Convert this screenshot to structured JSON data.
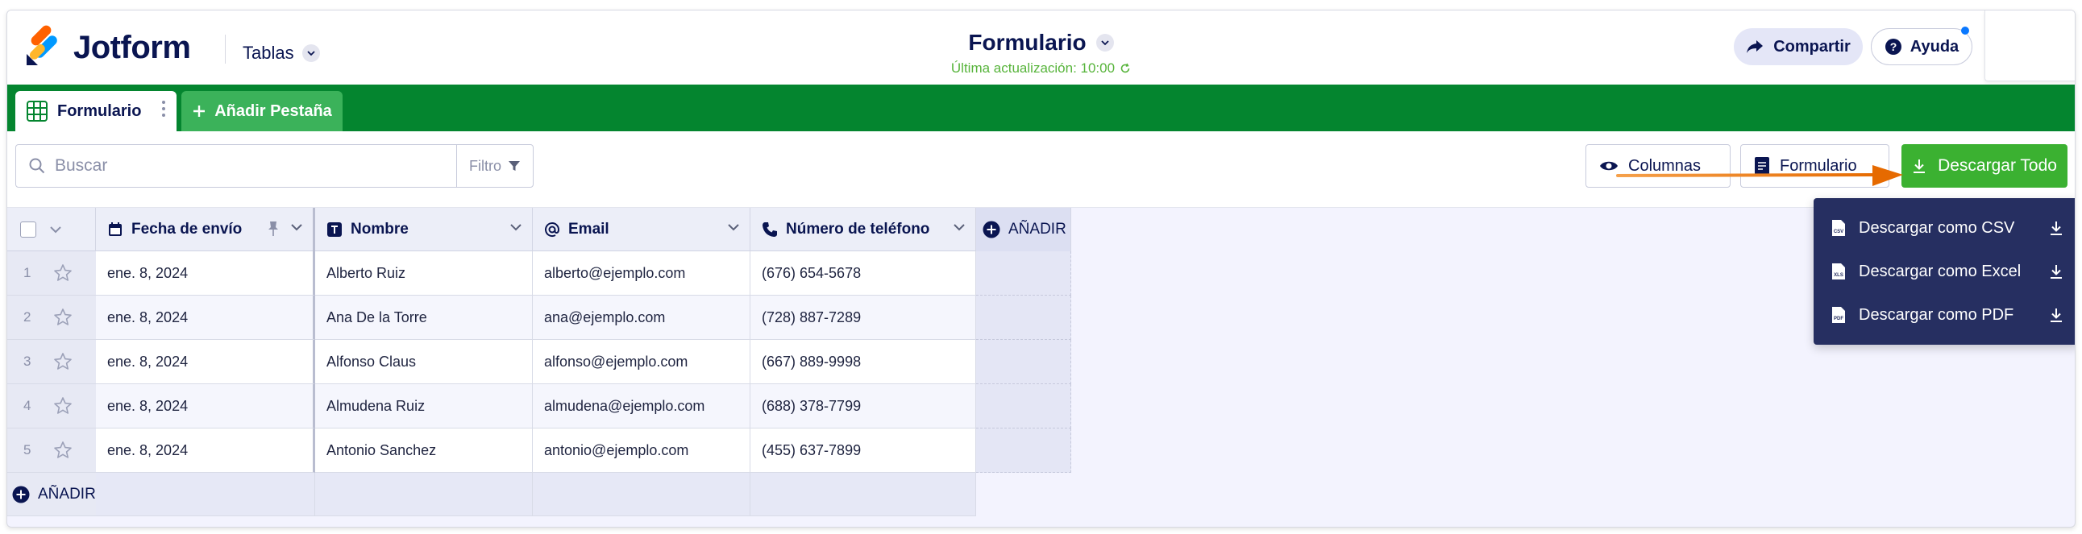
{
  "header": {
    "brand": "Jotform",
    "tables_label": "Tablas",
    "form_title": "Formulario",
    "last_update": "Última actualización: 10:00",
    "share_label": "Compartir",
    "help_label": "Ayuda"
  },
  "tabs": {
    "active_tab": "Formulario",
    "add_tab": "Añadir Pestaña"
  },
  "toolbar": {
    "search_placeholder": "Buscar",
    "filter_label": "Filtro",
    "columns_label": "Columnas",
    "form_label": "Formulario",
    "download_all_label": "Descargar Todo"
  },
  "table": {
    "columns": [
      "Fecha de envío",
      "Nombre",
      "Email",
      "Número de teléfono"
    ],
    "add_column_label": "AÑADIR",
    "add_row_label": "AÑADIR",
    "rows": [
      {
        "n": "1",
        "fecha": "ene. 8, 2024",
        "nombre": "Alberto Ruiz",
        "email": "alberto@ejemplo.com",
        "telefono": "(676) 654-5678"
      },
      {
        "n": "2",
        "fecha": "ene. 8, 2024",
        "nombre": "Ana De la Torre",
        "email": "ana@ejemplo.com",
        "telefono": "(728) 887-7289"
      },
      {
        "n": "3",
        "fecha": "ene. 8, 2024",
        "nombre": "Alfonso Claus",
        "email": "alfonso@ejemplo.com",
        "telefono": "(667) 889-9998"
      },
      {
        "n": "4",
        "fecha": "ene. 8, 2024",
        "nombre": "Almudena Ruiz",
        "email": "almudena@ejemplo.com",
        "telefono": "(688) 378-7799"
      },
      {
        "n": "5",
        "fecha": "ene. 8, 2024",
        "nombre": "Antonio Sanchez",
        "email": "antonio@ejemplo.com",
        "telefono": "(455) 637-7899"
      }
    ]
  },
  "download_menu": {
    "items": [
      "Descargar como CSV",
      "Descargar como Excel",
      "Descargar como PDF"
    ]
  },
  "colors": {
    "brand_green": "#04852f",
    "download_green": "#3bb131",
    "menu_bg": "#262f61",
    "annotation_arrow": "#f07f0a",
    "navy": "#0a1551"
  }
}
